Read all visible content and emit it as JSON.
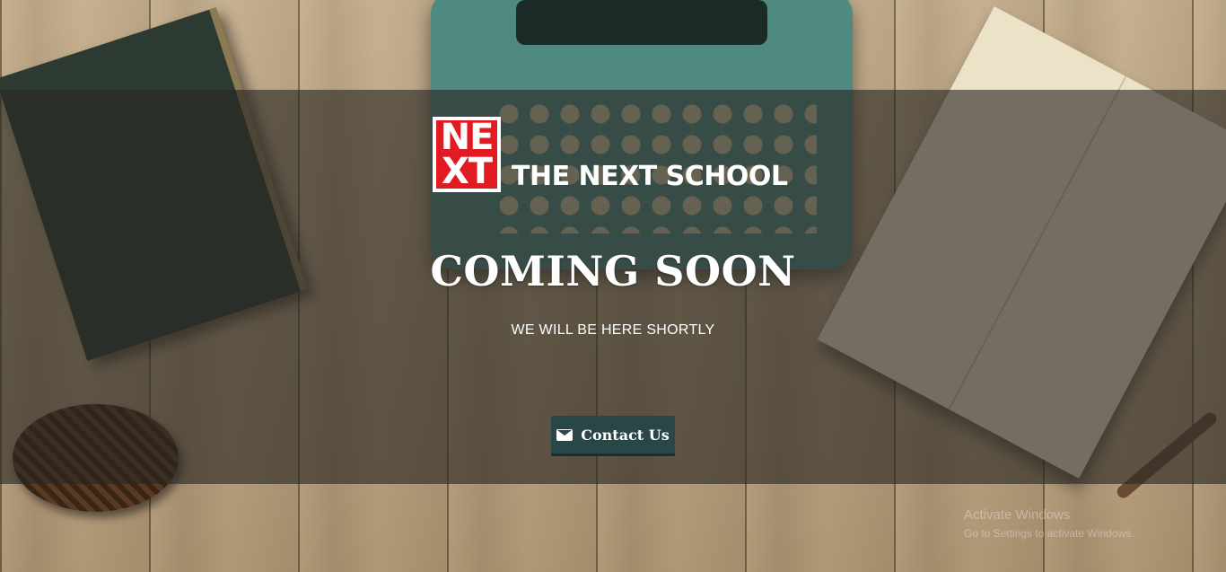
{
  "brand": {
    "logo_top": "NE",
    "logo_bottom": "XT",
    "name": "THE NEXT SCHOOL",
    "logo_color": "#e11b22"
  },
  "hero": {
    "heading": "COMING SOON",
    "subheading": "WE WILL BE HERE SHORTLY",
    "overlay_color": "rgba(40,38,34,0.62)"
  },
  "contact_button": {
    "label": "Contact Us",
    "icon": "envelope-icon",
    "color": "#2a4748"
  },
  "watermark": {
    "title": "Activate Windows",
    "subtitle": "Go to Settings to activate Windows."
  }
}
